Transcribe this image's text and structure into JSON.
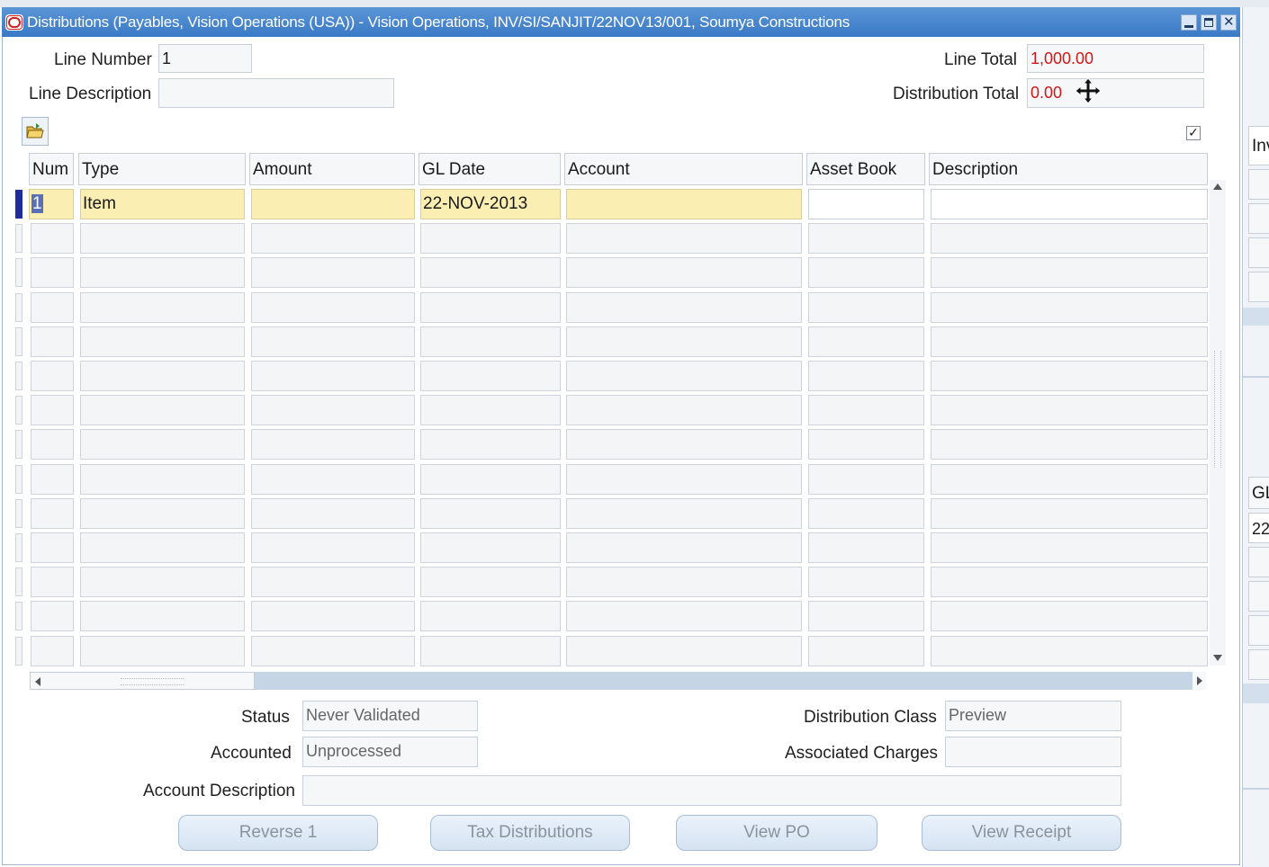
{
  "window": {
    "title": "Distributions (Payables, Vision Operations (USA)) - Vision Operations, INV/SI/SANJIT/22NOV13/001, Soumya Constructions"
  },
  "header": {
    "line_number_label": "Line Number",
    "line_number_value": "1",
    "line_description_label": "Line Description",
    "line_description_value": "",
    "line_total_label": "Line Total",
    "line_total_value": "1,000.00",
    "distribution_total_label": "Distribution Total",
    "distribution_total_value": "0.00"
  },
  "table": {
    "columns": [
      "Num",
      "Type",
      "Amount",
      "GL Date",
      "Account",
      "Asset Book",
      "Description"
    ],
    "rows": [
      [
        "1",
        "Item",
        "",
        "22-NOV-2013",
        "",
        "",
        ""
      ]
    ]
  },
  "footer": {
    "status_label": "Status",
    "status_value": "Never Validated",
    "accounted_label": "Accounted",
    "accounted_value": "Unprocessed",
    "account_description_label": "Account Description",
    "account_description_value": "",
    "distribution_class_label": "Distribution Class",
    "distribution_class_value": "Preview",
    "associated_charges_label": "Associated Charges",
    "associated_charges_value": ""
  },
  "buttons": {
    "reverse": "Reverse 1",
    "tax_distributions": "Tax Distributions",
    "view_po": "View PO",
    "view_receipt": "View Receipt"
  },
  "background_window": {
    "tab_fragment": "Inv",
    "gl_fragment": "GL",
    "value_fragment": "22"
  },
  "colors": {
    "title_bar": "#3a79c6",
    "current_row": "#fbeeb3",
    "total_value": "#d01818",
    "current_row_indicator": "#1e2c9c"
  },
  "icons": [
    "oracle-icon",
    "minimize-icon",
    "maximize-icon",
    "close-icon",
    "folder-icon",
    "move-cursor-icon",
    "checkbox-icon",
    "scroll-up-icon",
    "scroll-down-icon",
    "scroll-left-icon",
    "scroll-right-icon"
  ]
}
